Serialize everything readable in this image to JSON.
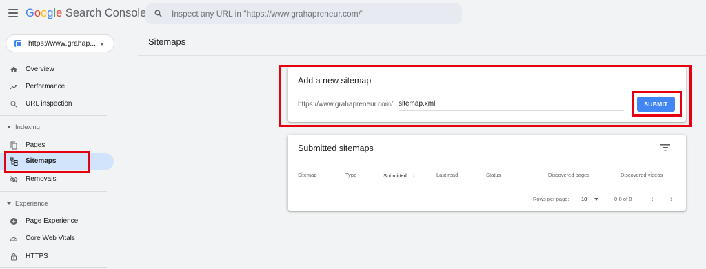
{
  "header": {
    "logo_word": "Google",
    "app_name": "Search Console",
    "search_placeholder": "Inspect any URL in \"https://www.grahapreneur.com/\""
  },
  "property": {
    "label": "https://www.grahap..."
  },
  "sidebar": {
    "items": [
      {
        "label": "Overview",
        "icon": "home-icon"
      },
      {
        "label": "Performance",
        "icon": "trending-up-icon"
      },
      {
        "label": "URL inspection",
        "icon": "search-icon"
      }
    ],
    "indexing": {
      "title": "Indexing",
      "items": [
        {
          "label": "Pages",
          "icon": "pages-icon"
        },
        {
          "label": "Sitemaps",
          "icon": "sitemap-icon",
          "active": true
        },
        {
          "label": "Removals",
          "icon": "visibility-off-icon"
        }
      ]
    },
    "experience": {
      "title": "Experience",
      "items": [
        {
          "label": "Page Experience",
          "icon": "add-circle-icon"
        },
        {
          "label": "Core Web Vitals",
          "icon": "speed-icon"
        },
        {
          "label": "HTTPS",
          "icon": "lock-icon"
        }
      ]
    }
  },
  "main": {
    "page_title": "Sitemaps",
    "add_card": {
      "title": "Add a new sitemap",
      "prefix": "https://www.grahapreneur.com/",
      "input_value": "sitemap.xml",
      "submit_label": "SUBMIT"
    },
    "submitted_card": {
      "title": "Submitted sitemaps",
      "columns": [
        "Sitemap",
        "Type",
        "Submitted",
        "Last read",
        "Status",
        "Discovered pages",
        "Discovered videos"
      ],
      "sort_arrow": "↓",
      "rows_per_page_label": "Rows per page:",
      "rows_per_page_value": "10",
      "range": "0-0 of 0",
      "prev": "‹",
      "next": "›"
    }
  },
  "colors": {
    "accent": "#4285f4",
    "highlight": "#e4000f",
    "active_nav": "#d2e3fc"
  }
}
